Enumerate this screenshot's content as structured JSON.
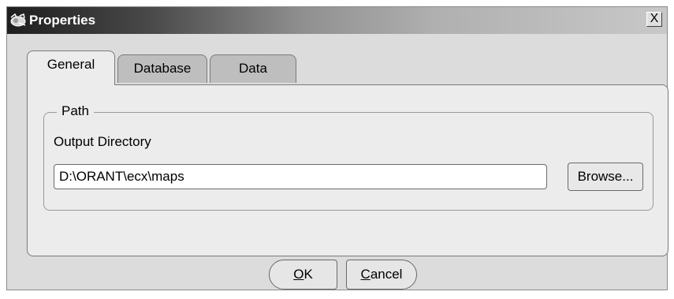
{
  "window": {
    "title": "Properties",
    "close_label": "X",
    "title_icon": "properties-app-icon"
  },
  "tabs": [
    {
      "label": "General",
      "active": true
    },
    {
      "label": "Database",
      "active": false
    },
    {
      "label": "Data",
      "active": false
    }
  ],
  "general": {
    "group_label": "Path",
    "output_dir_label": "Output Directory",
    "output_dir_value": "D:\\ORANT\\ecx\\maps",
    "browse_label": "Browse..."
  },
  "footer": {
    "ok_mnemonic": "O",
    "ok_rest": "K",
    "cancel_mnemonic": "C",
    "cancel_rest": "ancel"
  },
  "colors": {
    "window_bg": "#dcdcdc",
    "inactive_tab_bg": "#bebebe",
    "panel_bg": "#ececec",
    "title_text": "#ffffff"
  }
}
